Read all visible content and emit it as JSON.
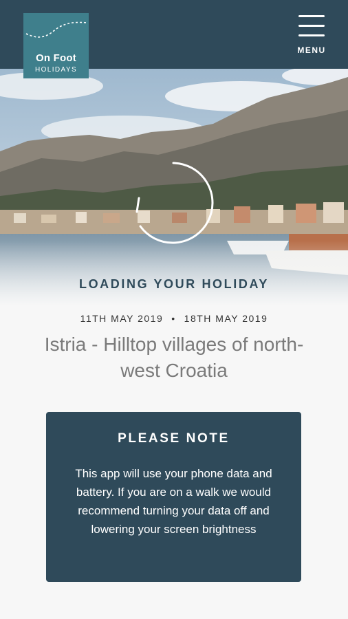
{
  "header": {
    "logo": {
      "title": "On Foot",
      "subtitle": "HOLIDAYS"
    },
    "menu_label": "MENU"
  },
  "colors": {
    "header_bg": "#2f4a5a",
    "logo_bg": "#3f7f8c",
    "note_bg": "#2f4a5a",
    "page_bg": "#f7f7f7"
  },
  "loading": {
    "title": "LOADING YOUR HOLIDAY",
    "start_date": "11TH MAY 2019",
    "separator": "•",
    "end_date": "18TH MAY 2019",
    "trip_name": "Istria - Hilltop villages of north-west Croatia"
  },
  "note": {
    "title": "PLEASE NOTE",
    "body": "This app will use your phone data and battery. If you are on a walk we would recommend turning your data off and lowering your screen brightness"
  },
  "icons": {
    "menu": "hamburger-menu-icon",
    "spinner": "loading-spinner-icon"
  }
}
